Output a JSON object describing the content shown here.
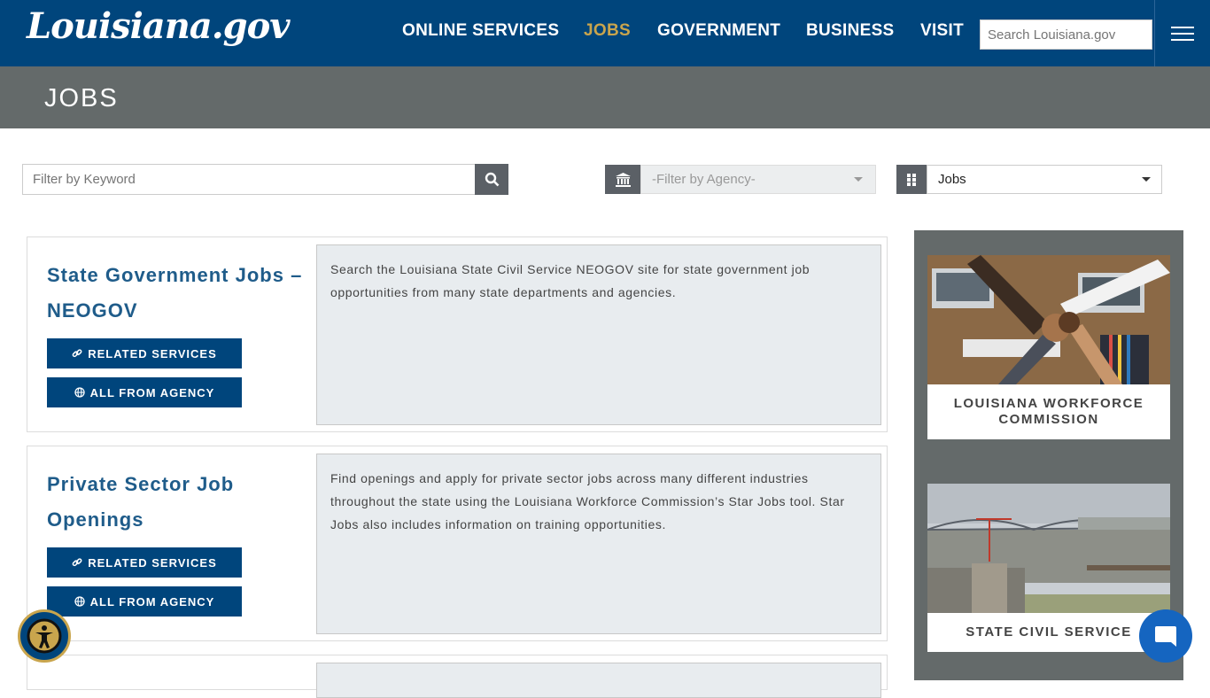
{
  "header": {
    "logo": "Louisiana.gov",
    "nav": [
      {
        "label": "ONLINE SERVICES",
        "active": false
      },
      {
        "label": "JOBS",
        "active": true
      },
      {
        "label": "GOVERNMENT",
        "active": false
      },
      {
        "label": "BUSINESS",
        "active": false
      },
      {
        "label": "VISIT",
        "active": false
      }
    ],
    "search_placeholder": "Search Louisiana.gov"
  },
  "banner": {
    "title": "JOBS"
  },
  "filters": {
    "keyword_placeholder": "Filter by Keyword",
    "agency_selected": "-Filter by Agency-",
    "category_selected": "Jobs"
  },
  "cards": [
    {
      "title": "State Government Jobs – NEOGOV",
      "related_label": "RELATED SERVICES",
      "agency_label": "ALL FROM AGENCY",
      "description": "Search the Louisiana State Civil Service NEOGOV site for state government job opportunities from many state departments and agencies."
    },
    {
      "title": "Private Sector Job Openings",
      "related_label": "RELATED SERVICES",
      "agency_label": "ALL FROM AGENCY",
      "description": "Find openings and apply for private sector jobs across many different industries throughout the state using the Louisiana Workforce Commission’s Star Jobs tool. Star Jobs also includes information on training opportunities."
    }
  ],
  "sidebar": [
    {
      "label": "LOUISIANA WORKFORCE COMMISSION"
    },
    {
      "label": "STATE CIVIL SERVICE"
    }
  ],
  "colors": {
    "header_bg": "#00457c",
    "active_nav": "#c9a54d",
    "banner_bg": "#646a6a",
    "card_title": "#1f5c8a"
  }
}
